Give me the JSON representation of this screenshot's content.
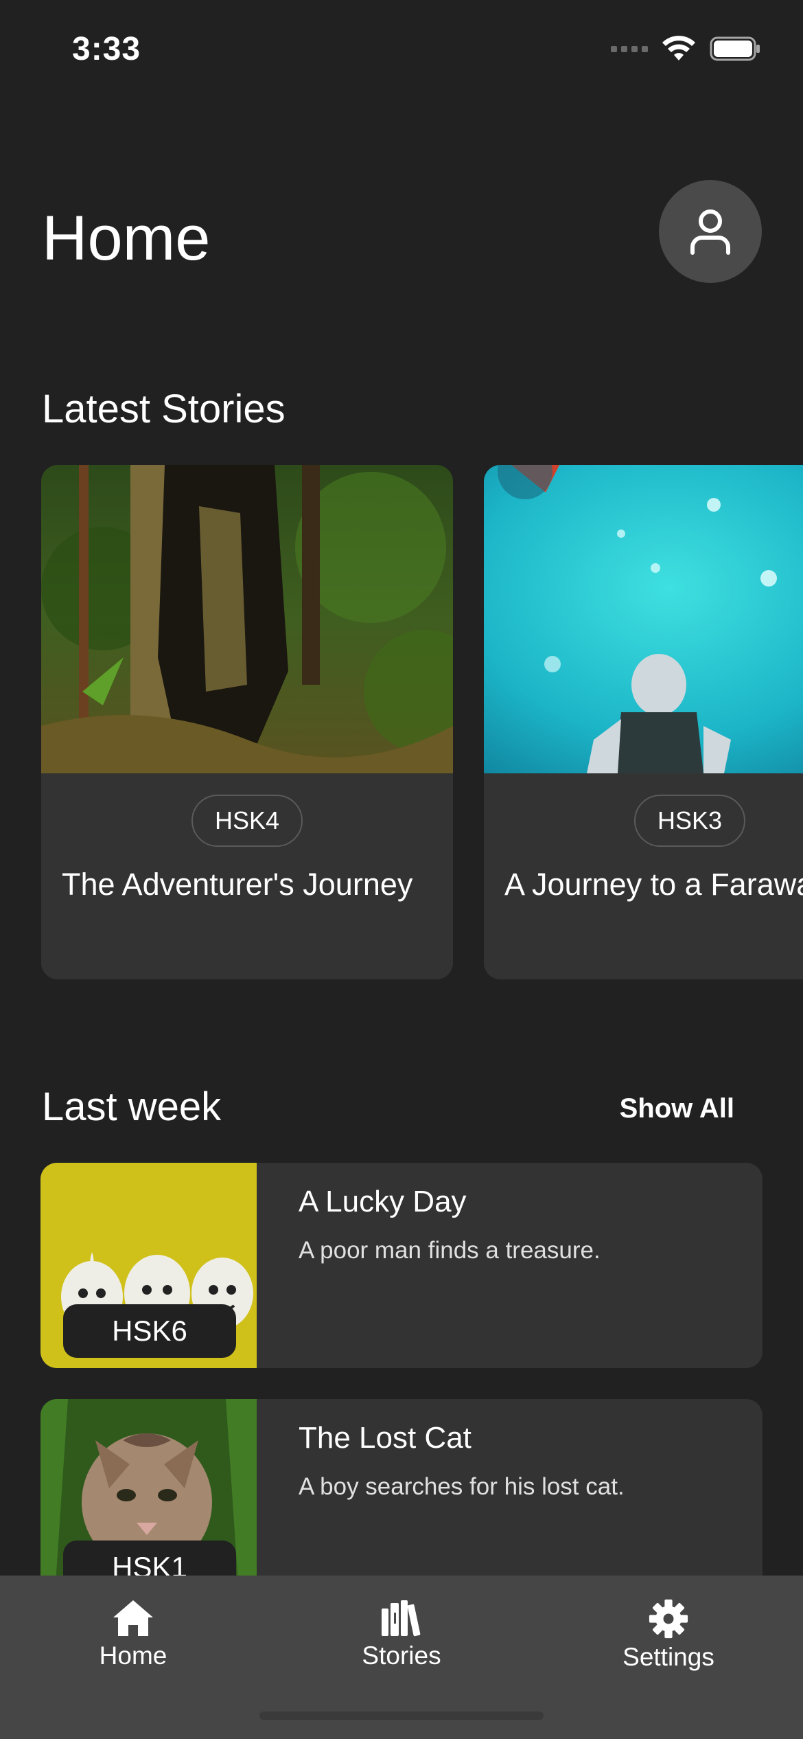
{
  "status_bar": {
    "time": "3:33"
  },
  "header": {
    "title": "Home"
  },
  "latest": {
    "section_title": "Latest Stories",
    "cards": [
      {
        "level": "HSK4",
        "title": "The Adventurer's Journey"
      },
      {
        "level": "HSK3",
        "title": "A Journey to a Faraway Land"
      }
    ]
  },
  "last_week": {
    "section_title": "Last week",
    "show_all": "Show All",
    "items": [
      {
        "title": "A Lucky Day",
        "description": "A poor man finds a treasure.",
        "level": "HSK6"
      },
      {
        "title": "The Lost Cat",
        "description": "A boy searches for his lost cat.",
        "level": "HSK1"
      }
    ]
  },
  "tab_bar": {
    "tabs": [
      {
        "label": "Home",
        "icon": "home-icon"
      },
      {
        "label": "Stories",
        "icon": "books-icon"
      },
      {
        "label": "Settings",
        "icon": "gear-icon"
      }
    ]
  },
  "colors": {
    "background": "#212121",
    "card": "#333333",
    "tab_bar": "#464646",
    "profile_button": "#4a4a4a"
  }
}
